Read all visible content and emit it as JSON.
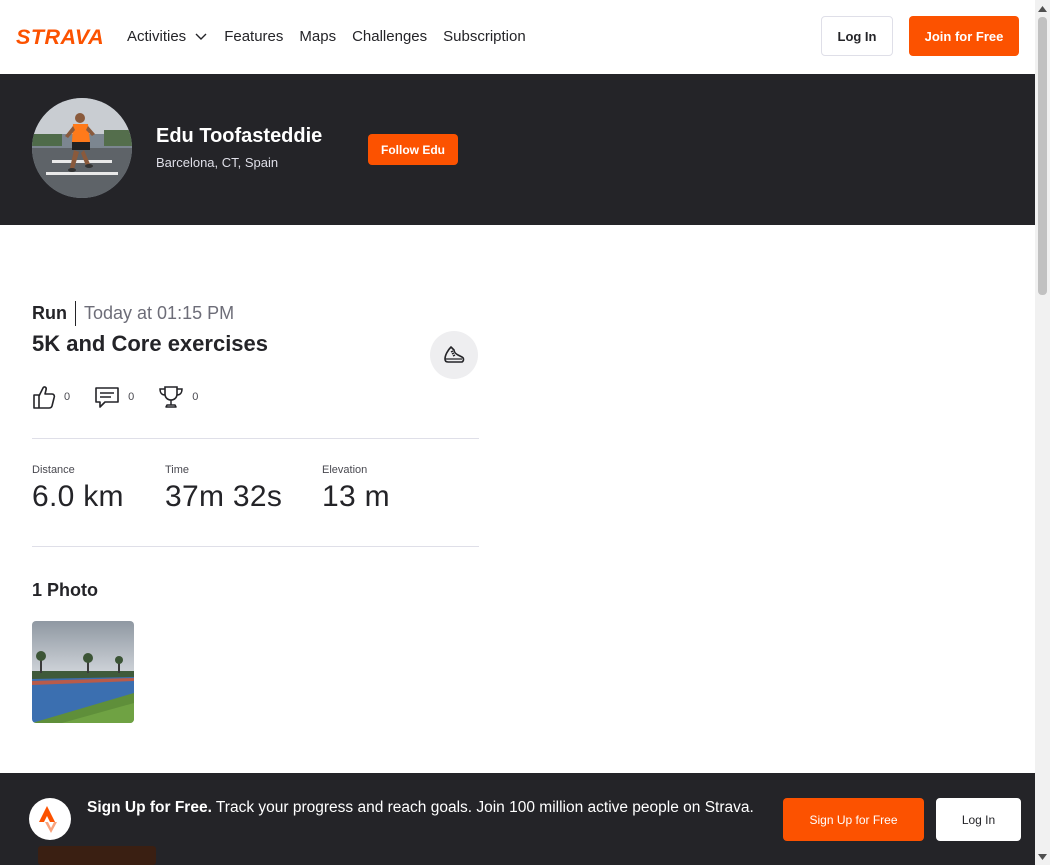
{
  "brand": {
    "logo_text": "STRAVA",
    "accent": "#fc5200",
    "dark": "#242428"
  },
  "nav": {
    "items": [
      {
        "label": "Activities"
      },
      {
        "label": "Features"
      },
      {
        "label": "Maps"
      },
      {
        "label": "Challenges"
      },
      {
        "label": "Subscription"
      }
    ],
    "login_label": "Log In",
    "join_label": "Join for Free"
  },
  "athlete": {
    "name": "Edu Toofasteddie",
    "location": "Barcelona, CT, Spain",
    "follow_label": "Follow Edu"
  },
  "activity": {
    "type": "Run",
    "date": "Today at 01:15 PM",
    "title": "5K and Core exercises",
    "sport_icon": "running-shoe-icon",
    "kudos_count": "0",
    "comments_count": "0",
    "achievements_count": "0",
    "stats": [
      {
        "label": "Distance",
        "value": "6.0 km"
      },
      {
        "label": "Time",
        "value": "37m 32s"
      },
      {
        "label": "Elevation",
        "value": "13 m"
      }
    ],
    "photos_heading": "1 Photo"
  },
  "banner": {
    "headline": "Sign Up for Free.",
    "text": "Track your progress and reach goals. Join 100 million active people on Strava.",
    "signup_label": "Sign Up for Free",
    "login_label": "Log In"
  }
}
